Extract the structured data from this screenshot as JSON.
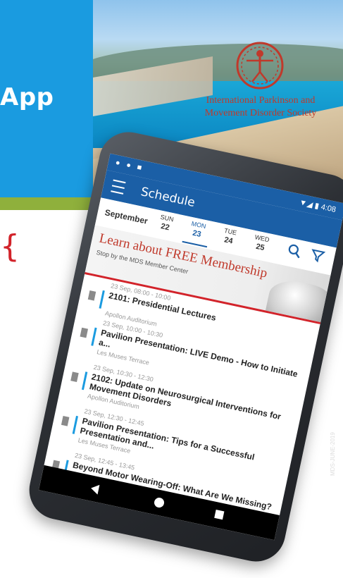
{
  "banner": {
    "title": "App",
    "society_name": "International Parkinson and Movement Disorder Society",
    "colors": {
      "blue": "#1a9be0",
      "green": "#8fb03c",
      "red": "#d2232a"
    }
  },
  "side_code": "MDS-JUNE-2019",
  "phone": {
    "status": {
      "left_icons": "● ● ■",
      "right": "▼◢ ▮ 4:08"
    },
    "app_bar": {
      "title": "Schedule",
      "menu_icon": "hamburger-icon",
      "search_icon": "search-icon",
      "filter_icon": "filter-icon"
    },
    "date_strip": {
      "month": "September",
      "days": [
        {
          "dow": "SUN",
          "num": "22",
          "active": false
        },
        {
          "dow": "MON",
          "num": "23",
          "active": true
        },
        {
          "dow": "TUE",
          "num": "24",
          "active": false
        },
        {
          "dow": "WED",
          "num": "25",
          "active": false
        }
      ]
    },
    "promo": {
      "title": "Learn about FREE Membership",
      "subtitle": "Stop by the MDS Member Center"
    },
    "sessions": [
      {
        "time": "23 Sep, 08:00 - 10:00",
        "title": "2101: Presidential Lectures",
        "location": "Apollon Auditorium"
      },
      {
        "time": "23 Sep, 10:00 - 10:30",
        "title": "Pavilion Presentation: LIVE Demo - How to Initiate a...",
        "location": "Les Muses Terrace"
      },
      {
        "time": "23 Sep, 10:30 - 12:30",
        "title": "2102: Update on Neurosurgical Interventions for Movement Disorders",
        "location": "Apollon Auditorium"
      },
      {
        "time": "23 Sep, 12:30 - 12:45",
        "title": "Pavilion Presentation: Tips for a Successful Presentation and...",
        "location": "Les Muses Terrace"
      },
      {
        "time": "23 Sep, 12:45 - 13:45",
        "title": "Beyond Motor Wearing-Off: What Are We Missing?",
        "location": ""
      }
    ],
    "nav": {
      "back": "back-icon",
      "home": "home-icon",
      "recent": "recent-apps-icon"
    }
  }
}
